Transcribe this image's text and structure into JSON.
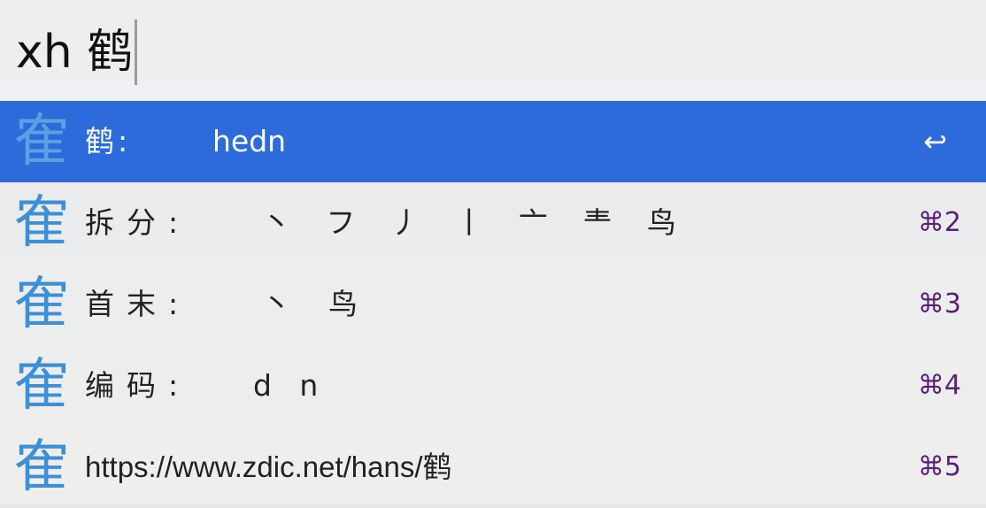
{
  "search": {
    "query": "xh 鹤"
  },
  "results": [
    {
      "icon_glyph": "隺",
      "icon_name": "character-icon",
      "label": "鹤:",
      "value": "hedn",
      "shortcut": "↩",
      "selected": true
    },
    {
      "icon_glyph": "隺",
      "icon_name": "character-icon",
      "label": "拆分:",
      "value": "丶   フ   丿   丨   亠   龶   鸟",
      "shortcut": "⌘2",
      "selected": false
    },
    {
      "icon_glyph": "隺",
      "icon_name": "character-icon",
      "label": "首末:",
      "value": "丶    鸟",
      "shortcut": "⌘3",
      "selected": false
    },
    {
      "icon_glyph": "隺",
      "icon_name": "character-icon",
      "label": "编码:",
      "value": "d   n",
      "shortcut": "⌘4",
      "selected": false
    },
    {
      "icon_glyph": "隺",
      "icon_name": "character-icon",
      "label": "https://www.zdic.net/hans/鹤",
      "value": "",
      "shortcut": "⌘5",
      "selected": false
    }
  ],
  "colors": {
    "selection": "#2c6bd9",
    "icon": "#3d8fd6",
    "shortcut": "#5a1f7a"
  }
}
